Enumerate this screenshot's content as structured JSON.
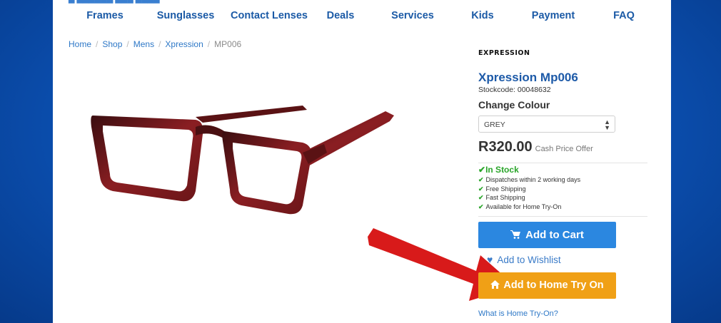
{
  "nav": {
    "items": [
      "Frames",
      "Sunglasses",
      "Contact Lenses",
      "Deals",
      "Services",
      "Kids",
      "Payment",
      "FAQ"
    ]
  },
  "breadcrumb": {
    "items": [
      "Home",
      "Shop",
      "Mens",
      "Xpression"
    ],
    "current": "MP006"
  },
  "product": {
    "brand": "EXPRESSION",
    "title": "Xpression Mp006",
    "stockcode": "Stockcode: 00048632",
    "change_colour_label": "Change Colour",
    "colour_selected": "GREY",
    "price": "R320.00",
    "price_note": "Cash Price Offer",
    "availability": "In Stock",
    "features": [
      "Dispatches within 2 working days",
      "Free Shipping",
      "Fast Shipping",
      "Available for Home Try-On"
    ],
    "add_to_cart": "Add to Cart",
    "add_to_wishlist": "Add to Wishlist",
    "add_to_home_try_on": "Add to Home Try On",
    "what_is_link": "What is Home Try-On?"
  },
  "colors": {
    "nav_text": "#1b5aa6",
    "cart_button": "#2b87e0",
    "home_try_on_button": "#f0a016",
    "in_stock": "#2aa52a",
    "annotation_arrow": "#d81a1a",
    "frame": "#7a1a1c"
  },
  "icons": {
    "cart": "shopping-cart-icon",
    "wishlist": "heart-icon",
    "home": "home-icon",
    "check": "check-icon",
    "select": "select-arrows-icon"
  }
}
